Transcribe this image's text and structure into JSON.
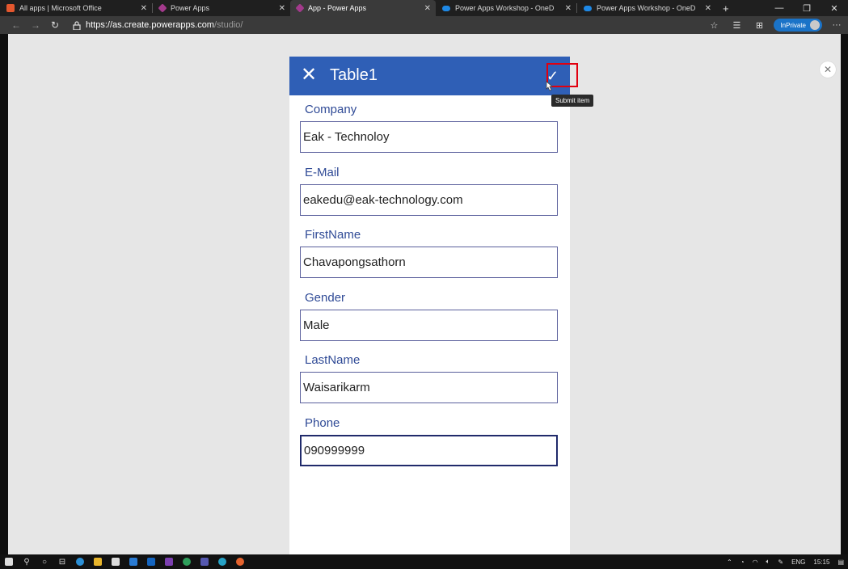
{
  "browser": {
    "tabs": [
      {
        "label": "All apps | Microsoft Office",
        "icon": "office-icon",
        "color": "#e4572e",
        "active": false
      },
      {
        "label": "Power Apps",
        "icon": "powerapps-icon",
        "color": "#a33a8c",
        "active": false
      },
      {
        "label": "App - Power Apps",
        "icon": "powerapps-icon",
        "color": "#a33a8c",
        "active": true
      },
      {
        "label": "Power Apps Workshop - OneD",
        "icon": "onedrive-icon",
        "color": "#1e88e5",
        "active": false
      },
      {
        "label": "Power Apps Workshop - OneD",
        "icon": "onedrive-icon",
        "color": "#1e88e5",
        "active": false
      }
    ],
    "new_tab": "+",
    "url_host": "https://as.create.powerapps.com",
    "url_path": "/studio/",
    "inprivate_label": "InPrivate"
  },
  "app": {
    "title": "Table1",
    "close_glyph": "✕",
    "submit_glyph": "✓",
    "tooltip": "Submit item",
    "accent": "#2f5fb6",
    "fields": [
      {
        "label": "Company",
        "value": "Eak - Technoloy"
      },
      {
        "label": "E-Mail",
        "value": "eakedu@eak-technology.com"
      },
      {
        "label": "FirstName",
        "value": "Chavapongsathorn"
      },
      {
        "label": "Gender",
        "value": "Male"
      },
      {
        "label": "LastName",
        "value": "Waisarikarm"
      },
      {
        "label": "Phone",
        "value": "090999999"
      }
    ]
  },
  "taskbar": {
    "language": "ENG",
    "time": "15:15"
  }
}
